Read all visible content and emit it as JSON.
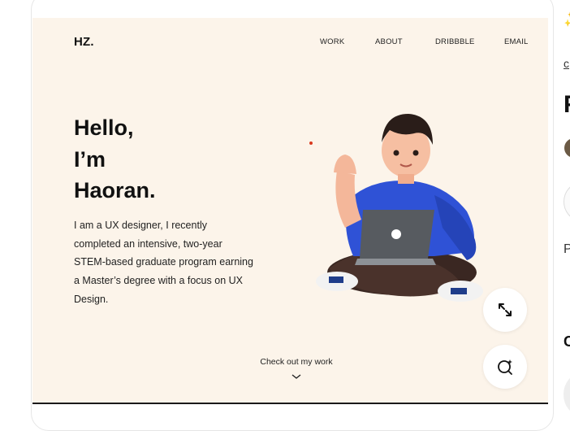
{
  "site": {
    "logo": "HZ.",
    "nav": [
      "WORK",
      "ABOUT",
      "DRIBBBLE",
      "EMAIL"
    ]
  },
  "hero": {
    "title_lines": [
      "Hello,",
      "I’m",
      "Haoran."
    ],
    "description": "I am a UX designer, I recently completed an intensive, two-year STEM-based graduate program earning a Master’s degree with a focus on UX Design.",
    "cta": "Check out my work"
  },
  "icons": {
    "expand": "expand-icon",
    "lens": "visual-search-icon",
    "cta_arrow": "chevron-down-icon"
  },
  "colors": {
    "page_bg": "#fcf4ea",
    "shirt": "#2f52d6",
    "accent_dot": "#d9381e"
  },
  "side_peek": {
    "link": "c",
    "title_fragment": "F",
    "text_fragment": "P",
    "heading_fragment": "C"
  }
}
